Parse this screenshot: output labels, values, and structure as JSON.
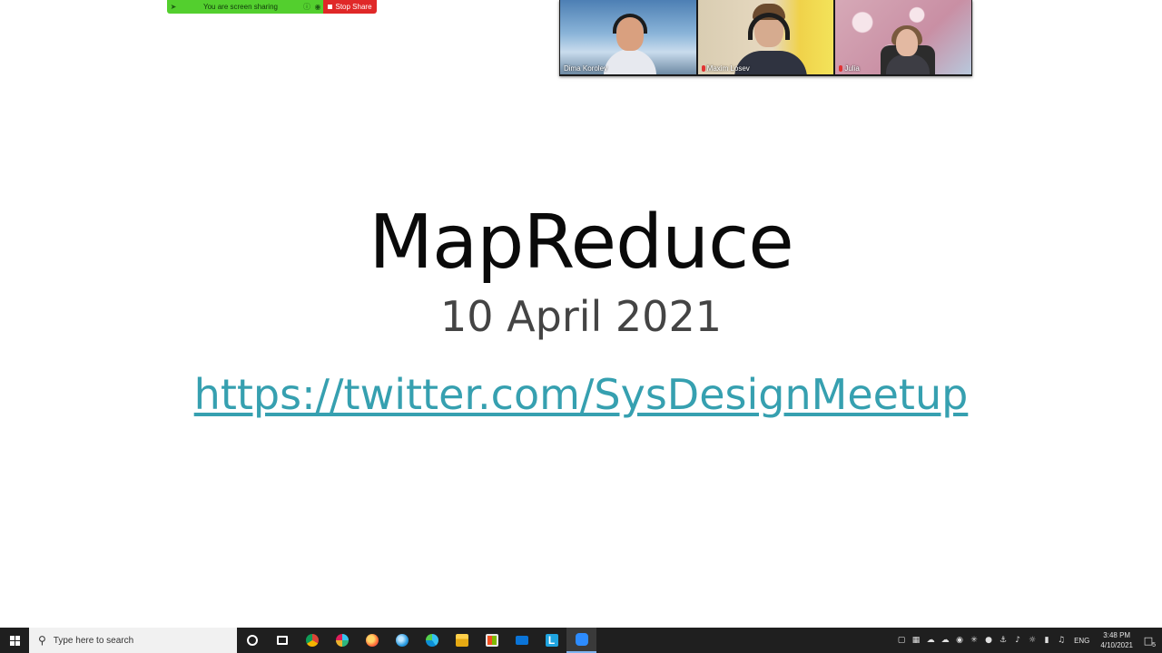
{
  "zoom": {
    "share_status": "You are screen sharing",
    "stop_share": "Stop Share",
    "participants": [
      {
        "name": "Dima Korolev",
        "muted": false
      },
      {
        "name": "Maxim Losev",
        "muted": true
      },
      {
        "name": "Julia",
        "muted": true
      }
    ]
  },
  "slide": {
    "title": "MapReduce",
    "date": "10 April 2021",
    "link": "https://twitter.com/SysDesignMeetup"
  },
  "taskbar": {
    "search_placeholder": "Type here to search",
    "apps": [
      "cortana-icon",
      "task-view-icon",
      "chrome-icon",
      "slack-icon",
      "firefox-nightly-icon",
      "fluent-app-icon",
      "edge-icon",
      "file-explorer-icon",
      "store-icon",
      "mail-icon",
      "lens-icon",
      "zoom-icon"
    ],
    "language": "ENG",
    "time": "3:48 PM",
    "date": "4/10/2021",
    "notifications": "5",
    "colors": {
      "taskbar_bg": "#1f1f1f",
      "chrome": "#db4437",
      "edge": "#0c8fd6",
      "zoom": "#2d8cff",
      "share_green": "#53cf2e",
      "stop_red": "#e02828",
      "link": "#36a0b0"
    }
  }
}
